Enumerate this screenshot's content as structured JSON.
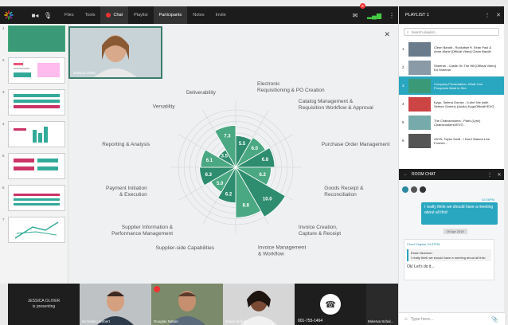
{
  "topbar": {
    "items": [
      "Files",
      "Tools",
      "Chat",
      "Playlist",
      "Participants",
      "Notes",
      "Invite"
    ],
    "notif_count": "6"
  },
  "slides": [
    "1",
    "2",
    "3",
    "4",
    "5",
    "6",
    "7"
  ],
  "presenter": {
    "name": "Jessica Oliver"
  },
  "chart_data": {
    "type": "polar-bar",
    "categories": [
      "Electronic Requisitioning & PO Creation",
      "Catalog Management & Requisition Workflow & Approval",
      "Purchase Order Management",
      "Goods Receipt & Reconciliation",
      "Invoice Creation, Capture & Receipt",
      "Invoice Management & Workflow",
      "Supplier-side Capabilities",
      "Supplier Information & Performance Management",
      "Payment Initiation & Execution",
      "Reporting & Analysis",
      "Versatility",
      "Deliverability"
    ],
    "values": [
      5.5,
      6.0,
      6.8,
      6.2,
      10.0,
      8.8,
      6.2,
      5.0,
      6.3,
      6.1,
      3.5,
      7.3
    ],
    "value_labels": [
      "5.5",
      "6.0",
      "6.8",
      "6.2",
      "10.0",
      "8.8",
      "6.2",
      "5.0",
      "6.3",
      "6.1",
      "3.5",
      "7.3"
    ],
    "rmax": 10,
    "colors": {
      "dark": "#2e8d6e",
      "light": "#4aa882"
    }
  },
  "bottom": {
    "presenting_line1": "JESSICA OLIVER",
    "presenting_line2": "is presenting",
    "participants": [
      "Nicholas Lambert",
      "Douglas Nation",
      "Grace Schultz"
    ],
    "phone": "001-755-1464",
    "extra": "Minerva Schul..."
  },
  "playlist": {
    "title": "PLAYLIST 1",
    "search_placeholder": "Search playlist...",
    "items": [
      {
        "n": "1",
        "text": "Clean Bandit - Rockabye ft. Sean Paul & Anne-Marie [Official Video] Clean Bandit"
      },
      {
        "n": "2",
        "text": "Sheeran - Castle On The Hill [Official Video] Ed Sheeran"
      },
      {
        "n": "3",
        "text": "Company Presentation: What Your Prospects Want to See"
      },
      {
        "n": "4",
        "text": "Kygo, Selena Gomez - It Ain't Me (with Selena Gomez) (Audio) KygoOfficialVEVO"
      },
      {
        "n": "5",
        "text": "The Chainsmokers - Paris (Lyric) ChainsmokersVEVO"
      },
      {
        "n": "6",
        "text": "ZAYN, Taylor Swift - I Don't Wanna Live Forever..."
      }
    ]
  },
  "chat": {
    "title": "ROOM CHAT",
    "my_message": "I really think we should have a meeting about all this!",
    "my_time": "02:08PM",
    "date": "09 Apr 2019",
    "reply_who": "Chad Clayton",
    "reply_time": "04:37PM",
    "quote_name": "Essie Newman",
    "quote_text": "I really think we should have a meeting about all this!",
    "reply_text": "Ok! Let's do it...",
    "input_placeholder": "Type here..."
  }
}
